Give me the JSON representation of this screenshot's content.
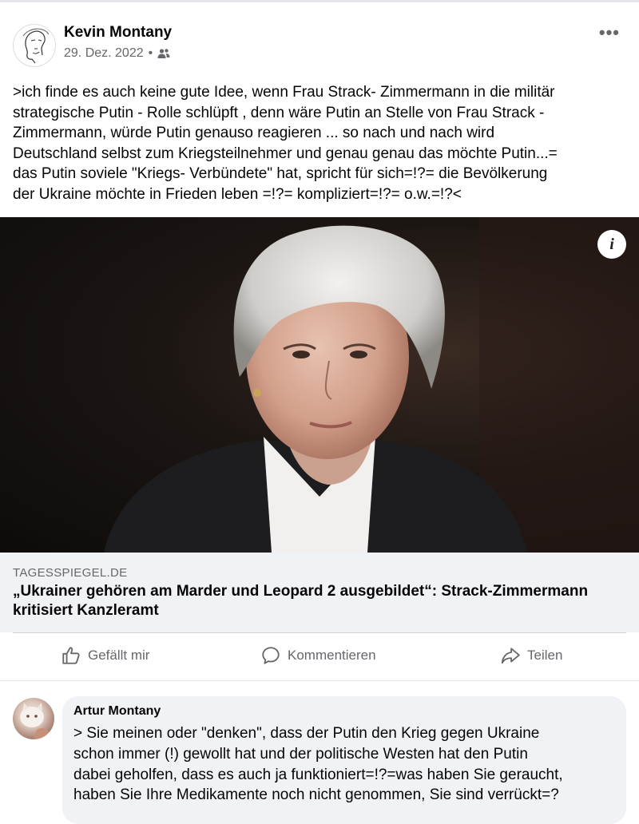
{
  "post": {
    "author": "Kevin Montany",
    "date": "29. Dez. 2022",
    "dot": "•",
    "audience_icon": "friends-icon",
    "more_icon": "more-options-icon",
    "text_lines": [
      ">ich finde es auch keine gute Idee, wenn Frau Strack- Zimmermann in die militär",
      "strategische Putin - Rolle schlüpft , denn wäre Putin an Stelle von Frau Strack -",
      "Zimmermann, würde Putin genauso reagieren ... so nach und nach wird",
      "Deutschland selbst zum Kriegsteilnehmer und genau genau das möchte Putin...=",
      "das Putin soviele \"Kriegs-  Verbündete\" hat, spricht für sich=!?=  die Bevölkerung",
      "der Ukraine möchte in Frieden leben =!?= kompliziert=!?= o.w.=!?<"
    ]
  },
  "link": {
    "info_label": "i",
    "domain": "TAGESSPIEGEL.DE",
    "title": "„Ukrainer gehören am Marder und Leopard 2 ausgebildet“: Strack-Zimmermann kritisiert Kanzleramt"
  },
  "actions": {
    "like": "Gefällt mir",
    "comment": "Kommentieren",
    "share": "Teilen"
  },
  "comment": {
    "author": "Artur Montany",
    "text_lines": [
      "> Sie meinen oder \"denken\", dass der Putin den Krieg gegen Ukraine",
      "schon immer (!) gewollt hat und der politische Westen hat den Putin",
      "dabei geholfen, dass es auch ja funktioniert=!?=was haben Sie geraucht,",
      "haben Sie Ihre Medikamente noch nicht genommen,  Sie sind verrückt=?"
    ]
  },
  "colors": {
    "text": "#050505",
    "secondary": "#65676b",
    "link_bg": "#f0f2f5",
    "divider": "#ced0d4"
  }
}
